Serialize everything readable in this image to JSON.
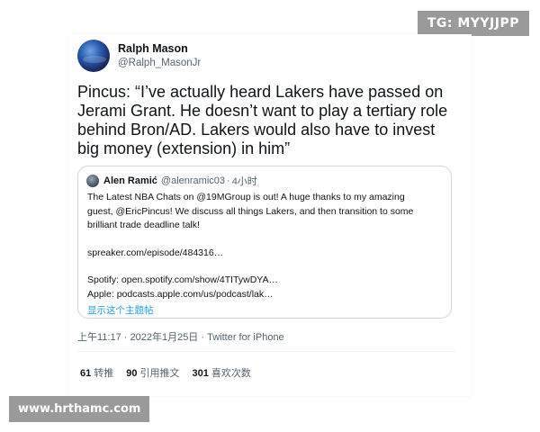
{
  "watermarks": {
    "top_right": "TG: MYYJJPP",
    "bottom_left": "www.hrthamc.com"
  },
  "tweet": {
    "author": {
      "display_name": "Ralph Mason",
      "handle": "@Ralph_MasonJr"
    },
    "text": "Pincus: “I’ve actually heard Lakers have passed on Jerami Grant. He doesn’t want to play a tertiary role behind Bron/AD. Lakers would also have to invest big money (extension) in him”",
    "quote": {
      "author_name": "Alen Ramić",
      "author_handle": "@alenramic03",
      "separator": "·",
      "time": "4小时",
      "lines": [
        "The Latest NBA Chats on @19MGroup is out! A huge thanks to my amazing",
        "guest, @EricPincus! We discuss all things Lakers, and then transition to some",
        "brilliant trade deadline talk!",
        "",
        "spreaker.com/episode/484316…",
        "",
        "Spotify: open.spotify.com/show/4TITywDYA…",
        "Apple: podcasts.apple.com/us/podcast/lak…"
      ],
      "show_thread": "显示这个主题帖"
    },
    "meta": "上午11:17 · 2022年1月25日 · Twitter for iPhone",
    "stats": [
      {
        "count": "61",
        "label": "转推"
      },
      {
        "count": "90",
        "label": "引用推文"
      },
      {
        "count": "301",
        "label": "喜欢次数"
      }
    ]
  },
  "colors": {
    "link": "#1d9bf0",
    "secondary_text": "#536471",
    "border": "#cfd9de",
    "watermark_bg": "#9a9a9a"
  }
}
